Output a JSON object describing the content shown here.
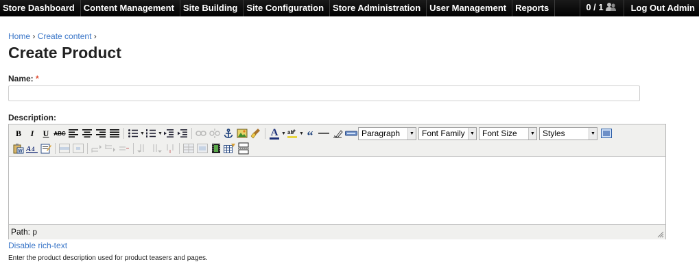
{
  "topbar": {
    "menu": [
      "Store Dashboard",
      "Content Management",
      "Site Building",
      "Site Configuration",
      "Store Administration",
      "User Management",
      "Reports"
    ],
    "user_count": "0 / 1",
    "logout": "Log Out Admin"
  },
  "breadcrumb": {
    "home": "Home",
    "sep1": "›",
    "create_content": "Create content",
    "sep2": "›"
  },
  "page_title": "Create Product",
  "form": {
    "name_label": "Name:",
    "required_marker": "*",
    "name_value": "",
    "description_label": "Description:"
  },
  "editor": {
    "selects": {
      "format": "Paragraph",
      "font_family": "Font Family",
      "font_size": "Font Size",
      "styles": "Styles"
    },
    "toolbar_row1_icons": [
      "bold-icon",
      "italic-icon",
      "underline-icon",
      "strikethrough-icon",
      "align-left-icon",
      "align-center-icon",
      "align-right-icon",
      "align-justify-icon",
      "bullet-list-icon",
      "numbered-list-icon",
      "outdent-icon",
      "indent-icon",
      "link-icon",
      "unlink-icon",
      "anchor-icon",
      "image-icon",
      "cleanup-icon",
      "text-color-icon",
      "highlight-color-icon",
      "blockquote-icon",
      "horizontal-rule-icon",
      "remove-format-icon",
      "visual-aid-icon"
    ],
    "toolbar_row2_icons": [
      "paste-word-icon",
      "spellcheck-icon",
      "edit-html-icon",
      "table-icon"
    ],
    "path_label": "Path:",
    "path_value": "p"
  },
  "disable_rich_text": "Disable rich-text",
  "help_text": "Enter the product description used for product teasers and pages."
}
